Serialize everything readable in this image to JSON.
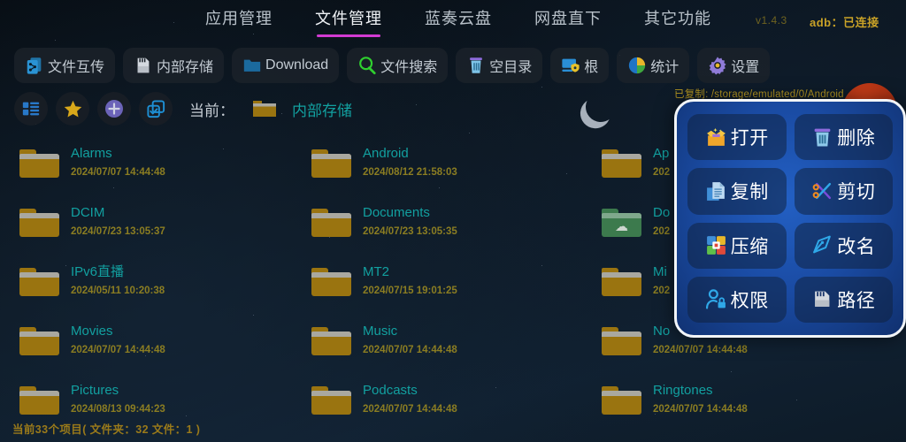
{
  "header": {
    "tabs": [
      {
        "label": "应用管理",
        "active": false
      },
      {
        "label": "文件管理",
        "active": true
      },
      {
        "label": "蓝奏云盘",
        "active": false
      },
      {
        "label": "网盘直下",
        "active": false
      },
      {
        "label": "其它功能",
        "active": false
      }
    ],
    "version": "v1.4.3",
    "adb_status": "adb：已连接"
  },
  "toolbar": [
    {
      "label": "文件互传",
      "icon": "file-transfer-icon"
    },
    {
      "label": "内部存储",
      "icon": "sdcard-icon"
    },
    {
      "label": "Download",
      "icon": "folder-icon"
    },
    {
      "label": "文件搜索",
      "icon": "search-icon"
    },
    {
      "label": "空目录",
      "icon": "trash-icon"
    },
    {
      "label": "根",
      "icon": "root-shield-icon"
    },
    {
      "label": "统计",
      "icon": "pie-chart-icon"
    },
    {
      "label": "设置",
      "icon": "gear-icon"
    }
  ],
  "actionbar": {
    "icons": [
      {
        "name": "list-view-icon"
      },
      {
        "name": "star-icon"
      },
      {
        "name": "add-icon"
      },
      {
        "name": "multi-select-icon"
      }
    ],
    "current_label": "当前：",
    "current_folder": "内部存储"
  },
  "toast": {
    "copied_text": "已复制: /storage/emulated/0/Android"
  },
  "files": {
    "col1": [
      {
        "name": "Alarms",
        "time": "2024/07/07 14:44:48",
        "type": "folder"
      },
      {
        "name": "DCIM",
        "time": "2024/07/23 13:05:37",
        "type": "folder"
      },
      {
        "name": "IPv6直播",
        "time": "2024/05/11 10:20:38",
        "type": "folder"
      },
      {
        "name": "Movies",
        "time": "2024/07/07 14:44:48",
        "type": "folder"
      },
      {
        "name": "Pictures",
        "time": "2024/08/13 09:44:23",
        "type": "folder"
      }
    ],
    "col2": [
      {
        "name": "Android",
        "time": "2024/08/12 21:58:03",
        "type": "folder"
      },
      {
        "name": "Documents",
        "time": "2024/07/23 13:05:35",
        "type": "folder"
      },
      {
        "name": "MT2",
        "time": "2024/07/15 19:01:25",
        "type": "folder"
      },
      {
        "name": "Music",
        "time": "2024/07/07 14:44:48",
        "type": "folder"
      },
      {
        "name": "Podcasts",
        "time": "2024/07/07 14:44:48",
        "type": "folder"
      }
    ],
    "col3": [
      {
        "name": "Ap",
        "time": "202",
        "type": "folder"
      },
      {
        "name": "Do",
        "time": "202",
        "type": "folder-download"
      },
      {
        "name": "Mi",
        "time": "202",
        "type": "folder"
      },
      {
        "name": "No",
        "time": "2024/07/07 14:44:48",
        "type": "folder"
      },
      {
        "name": "Ringtones",
        "time": "2024/07/07 14:44:48",
        "type": "folder"
      }
    ]
  },
  "popup": {
    "items": [
      {
        "label": "打开",
        "icon": "open-box-icon"
      },
      {
        "label": "删除",
        "icon": "trash-icon"
      },
      {
        "label": "复制",
        "icon": "copy-icon"
      },
      {
        "label": "剪切",
        "icon": "scissors-icon"
      },
      {
        "label": "压缩",
        "icon": "archive-icon"
      },
      {
        "label": "改名",
        "icon": "pen-icon"
      },
      {
        "label": "权限",
        "icon": "permission-lock-icon"
      },
      {
        "label": "路径",
        "icon": "path-sdcard-icon"
      }
    ]
  },
  "status": {
    "text": "当前33个项目( 文件夹：32   文件：1 )"
  },
  "colors": {
    "accent_tab": "#d23bd2",
    "folder_name": "#12a0a0",
    "timestamp": "#8b7d22",
    "adb": "#c9a227",
    "popup_bg": "#1a4ba3"
  }
}
